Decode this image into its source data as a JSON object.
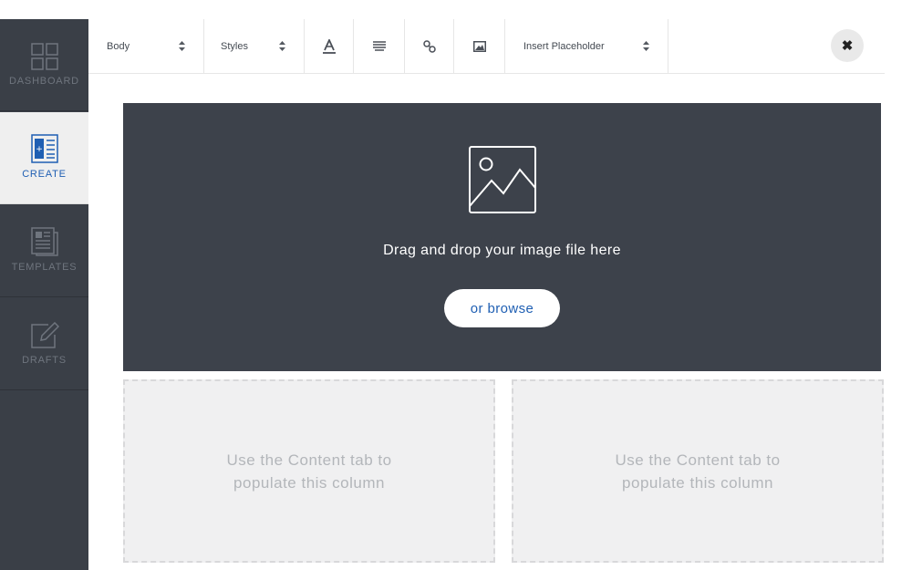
{
  "sidebar": {
    "items": [
      {
        "label": "DASHBOARD",
        "icon": "dashboard-grid-icon",
        "active": false
      },
      {
        "label": "CREATE",
        "icon": "create-layout-icon",
        "active": true
      },
      {
        "label": "TEMPLATES",
        "icon": "templates-document-icon",
        "active": false
      },
      {
        "label": "DRAFTS",
        "icon": "drafts-pencil-icon",
        "active": false
      }
    ]
  },
  "toolbar": {
    "text_style": "Body",
    "styles": "Styles",
    "placeholder_select": "Insert Placeholder",
    "icons": [
      "text-color-icon",
      "align-icon",
      "link-icon",
      "image-icon"
    ],
    "close_icon": "close-icon"
  },
  "dropzone": {
    "headline": "Drag and drop your image file here",
    "browse_label": "or browse",
    "icon": "image-placeholder-icon"
  },
  "columns": [
    {
      "message": "Use the Content tab to populate this column"
    },
    {
      "message": "Use the Content tab to populate this column"
    }
  ],
  "colors": {
    "sidebar": "#3a3f47",
    "accent": "#1f5fb3",
    "dropzone": "#3d424b"
  }
}
